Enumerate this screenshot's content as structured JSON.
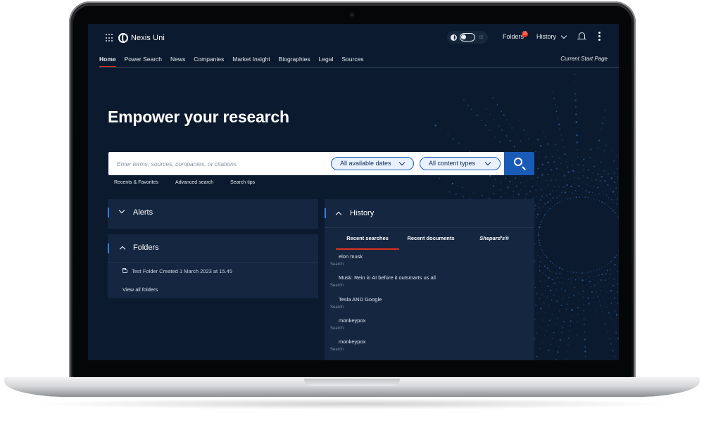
{
  "app": {
    "name": "Nexis Uni",
    "folders_label": "Folders",
    "folders_count": "11",
    "history_label": "History"
  },
  "nav": {
    "items": [
      "Home",
      "Power Search",
      "News",
      "Companies",
      "Market Insight",
      "Biographies",
      "Legal",
      "Sources"
    ],
    "active": "Home",
    "current_start_page": "Current Start Page"
  },
  "hero": {
    "title": "Empower your research"
  },
  "search": {
    "placeholder": "Enter terms, sources, companies, or citations",
    "dates_filter": "All available dates",
    "content_filter": "All content types",
    "links": [
      "Recents & Favorites",
      "Advanced search",
      "Search tips"
    ]
  },
  "alerts": {
    "title": "Alerts"
  },
  "folders": {
    "title": "Folders",
    "items": [
      "Test Folder Created 1 March 2023 at 15.45"
    ],
    "view_all": "View all folders"
  },
  "history": {
    "title": "History",
    "tabs": [
      "Recent searches",
      "Recent documents",
      "Shepard's®"
    ],
    "active_tab": "Recent searches",
    "items": [
      {
        "term": "elon musk",
        "type": "Search"
      },
      {
        "term": "Musk: Rein in AI before it outsmarts us all",
        "type": "Search"
      },
      {
        "term": "Tesla AND Google",
        "type": "Search"
      },
      {
        "term": "monkeypox",
        "type": "Search"
      },
      {
        "term": "monkeypox",
        "type": "Search"
      }
    ]
  },
  "colors": {
    "background": "#0b1a2e",
    "panel": "#142640",
    "accent_blue": "#1a5bb8",
    "active_underline": "#e0311f",
    "badge": "#e0311f"
  },
  "icons": [
    "app-grid-icon",
    "nexis-logo-icon",
    "moon-icon",
    "sun-icon",
    "chevron-down-icon",
    "bell-icon",
    "more-vertical-icon",
    "search-icon",
    "chevron-up-icon",
    "folder-icon"
  ]
}
